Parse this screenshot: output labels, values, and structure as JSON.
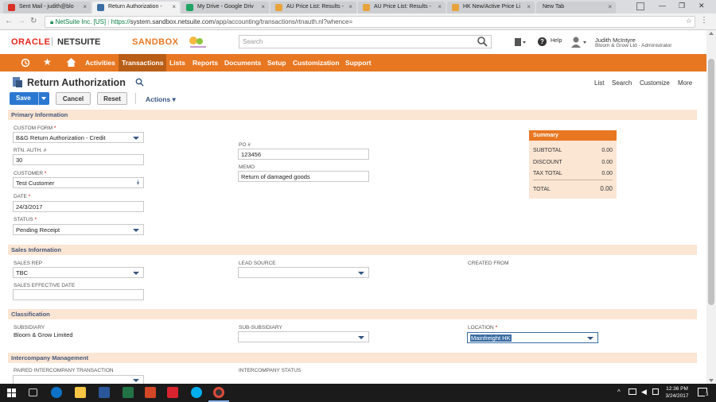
{
  "browser": {
    "tabs": [
      {
        "label": "Sent Mail - judith@blo",
        "active": false
      },
      {
        "label": "Return Authorization -",
        "active": true
      },
      {
        "label": "My Drive - Google Driv",
        "active": false
      },
      {
        "label": "AU Price List: Results -",
        "active": false
      },
      {
        "label": "AU Price List: Results -",
        "active": false
      },
      {
        "label": "HK New/Active Price Li",
        "active": false
      },
      {
        "label": "New Tab",
        "active": false
      }
    ],
    "site_label": "NetSuite Inc. [US]",
    "url_secure": "https://",
    "url_host": "system.sandbox.netsuite.com",
    "url_path": "/app/accounting/transactions/rtnauth.nl?whence="
  },
  "header": {
    "oracle_label": "ORACLE",
    "netsuite_label": "NETSUITE",
    "sandbox_label": "SANDBOX",
    "search_placeholder": "Search",
    "help_label": "Help",
    "user_name": "Judith McIntyre",
    "user_role": "Bloom & Grow Ltd - Administrator"
  },
  "menu": {
    "items": [
      "Activities",
      "Transactions",
      "Lists",
      "Reports",
      "Documents",
      "Setup",
      "Customization",
      "Support"
    ],
    "active": "Transactions"
  },
  "page": {
    "title": "Return Authorization",
    "links": [
      "List",
      "Search",
      "Customize",
      "More"
    ],
    "save_label": "Save",
    "cancel_label": "Cancel",
    "reset_label": "Reset",
    "actions_label": "Actions"
  },
  "primary": {
    "heading": "Primary Information",
    "custom_form_label": "CUSTOM FORM",
    "custom_form_value": "B&G Return Authorization - Credit",
    "rtn_auth_label": "RTN. AUTH. #",
    "rtn_auth_value": "30",
    "customer_label": "CUSTOMER",
    "customer_value": "Test Customer",
    "date_label": "DATE",
    "date_value": "24/3/2017",
    "status_label": "STATUS",
    "status_value": "Pending Receipt",
    "po_label": "PO #",
    "po_value": "123456",
    "memo_label": "MEMO",
    "memo_value": "Return of damaged goods"
  },
  "summary": {
    "title": "Summary",
    "rows": [
      {
        "label": "SUBTOTAL",
        "value": "0.00"
      },
      {
        "label": "DISCOUNT",
        "value": "0.00"
      },
      {
        "label": "TAX TOTAL",
        "value": "0.00"
      }
    ],
    "total_label": "TOTAL",
    "total_value": "0.00"
  },
  "sales": {
    "heading": "Sales Information",
    "sales_rep_label": "SALES REP",
    "sales_rep_value": "TBC",
    "lead_source_label": "LEAD SOURCE",
    "lead_source_value": "",
    "created_from_label": "CREATED FROM",
    "effective_date_label": "SALES EFFECTIVE DATE",
    "effective_date_value": ""
  },
  "classification": {
    "heading": "Classification",
    "subsidiary_label": "SUBSIDIARY",
    "subsidiary_value": "Bloom & Grow Limited",
    "sub_subsidiary_label": "SUB-SUBSIDIARY",
    "sub_subsidiary_value": "",
    "location_label": "LOCATION",
    "location_value": "Mainfreight HK"
  },
  "intercompany": {
    "heading": "Intercompany Management",
    "paired_label": "PAIRED INTERCOMPANY TRANSACTION",
    "status_label": "INTERCOMPANY STATUS"
  },
  "taskbar": {
    "time": "12:36 PM",
    "date": "3/24/2017",
    "notification_count": "3"
  },
  "colors": {
    "accent": "#e87722",
    "section_bg": "#fbe5d3",
    "primary_button": "#2b78d1"
  }
}
